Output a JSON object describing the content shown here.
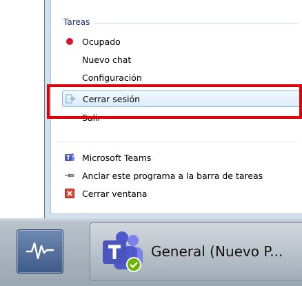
{
  "jumplist": {
    "section_title": "Tareas",
    "tasks": [
      {
        "label": "Ocupado",
        "icon": "red-dot-icon",
        "status_color": "#d8132c"
      },
      {
        "label": "Nuevo chat",
        "icon": ""
      },
      {
        "label": "Configuración",
        "icon": ""
      },
      {
        "label": "Cerrar sesión",
        "icon": "logout-icon",
        "selected": true
      },
      {
        "label": "Salir",
        "icon": ""
      }
    ],
    "footer_items": [
      {
        "label": "Microsoft Teams",
        "icon": "teams-icon"
      },
      {
        "label": "Anclar este programa a la barra de tareas",
        "icon": "pin-icon"
      },
      {
        "label": "Cerrar ventana",
        "icon": "close-window-icon"
      }
    ]
  },
  "taskbar": {
    "apps": [
      {
        "name": "Resource Monitor",
        "icon": "resource-monitor-icon"
      },
      {
        "label": "General (Nuevo P...",
        "icon": "teams-icon",
        "status": "available-checkmark"
      }
    ]
  },
  "colors": {
    "highlight": "#e0000a",
    "teams_purple": "#5059c9",
    "selection_border": "#7eb4ea",
    "status_busy": "#d8132c",
    "status_available": "#6bb700"
  }
}
